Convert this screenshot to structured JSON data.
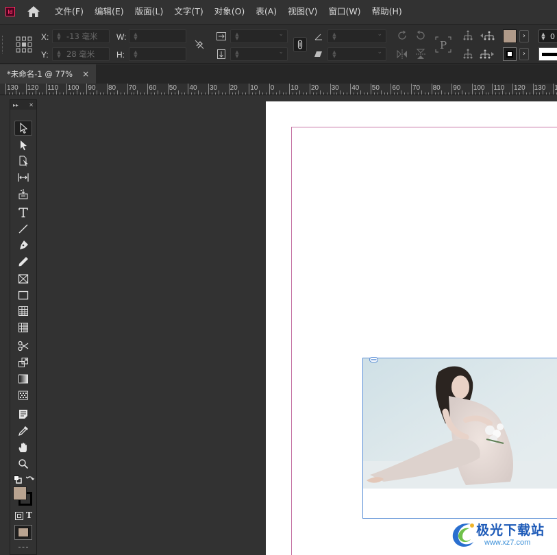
{
  "app": {
    "logo_text": "Id"
  },
  "menu": {
    "items": [
      {
        "label": "文件(F)"
      },
      {
        "label": "编辑(E)"
      },
      {
        "label": "版面(L)"
      },
      {
        "label": "文字(T)"
      },
      {
        "label": "对象(O)"
      },
      {
        "label": "表(A)"
      },
      {
        "label": "视图(V)"
      },
      {
        "label": "窗口(W)"
      },
      {
        "label": "帮助(H)"
      }
    ]
  },
  "control_panel": {
    "x_label": "X:",
    "x_value": "-13 毫米",
    "y_label": "Y:",
    "y_value": "28 毫米",
    "w_label": "W:",
    "w_value": "",
    "h_label": "H:",
    "h_value": "",
    "scale_x_value": "",
    "scale_y_value": "",
    "rotate_value": "",
    "shear_value": "",
    "fill_color": "#b09a89",
    "stroke_color": "#000000",
    "stroke_weight_value": "0"
  },
  "document": {
    "tab_title": "*未命名-1 @ 77%",
    "tab_close": "×"
  },
  "ruler": {
    "labels": [
      "130",
      "120",
      "110",
      "100",
      "90",
      "80",
      "70",
      "60",
      "50",
      "40",
      "30",
      "20",
      "10",
      "0",
      "10",
      "20",
      "30",
      "40",
      "50",
      "60",
      "70",
      "80",
      "90",
      "100",
      "110",
      "120",
      "130",
      "140"
    ]
  },
  "tools": {
    "header_collapse": "▸▸",
    "header_close": "✕",
    "swatch_fill_color": "#b8a390",
    "swatch_stroke_color": "#000000",
    "bottom_swatch_color": "#b8a390",
    "text_format_label": "T"
  },
  "colors": {
    "accent_frame": "#5b8fd6",
    "margin_guide": "#c777a6",
    "workspace": "#323232"
  },
  "watermark": {
    "title": "极光下载站",
    "url": "www.xz7.com"
  }
}
